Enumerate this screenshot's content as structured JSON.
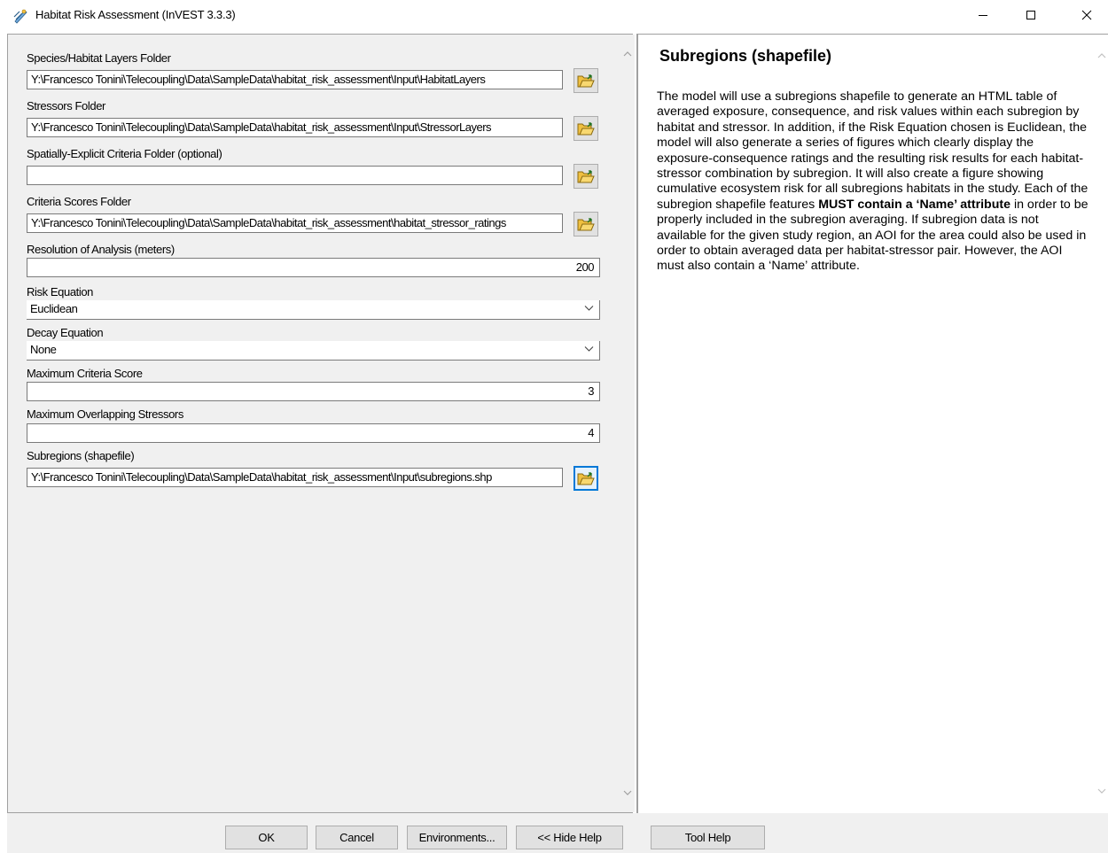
{
  "window": {
    "title": "Habitat Risk Assessment (InVEST 3.3.3)",
    "app_icon": "invest-app-icon",
    "controls": [
      "minimize-icon",
      "maximize-icon",
      "close-icon"
    ]
  },
  "form": {
    "fields": [
      {
        "label": "Species/Habitat Layers Folder",
        "value": "Y:\\Francesco Tonini\\Telecoupling\\Data\\SampleData\\habitat_risk_assessment\\Input\\HabitatLayers"
      },
      {
        "label": "Stressors Folder",
        "value": "Y:\\Francesco Tonini\\Telecoupling\\Data\\SampleData\\habitat_risk_assessment\\Input\\StressorLayers"
      },
      {
        "label": "Spatially-Explicit Criteria Folder (optional)",
        "value": ""
      },
      {
        "label": "Criteria Scores Folder",
        "value": "Y:\\Francesco Tonini\\Telecoupling\\Data\\SampleData\\habitat_risk_assessment\\habitat_stressor_ratings"
      },
      {
        "label": "Resolution of Analysis (meters)",
        "value": "200"
      },
      {
        "label": "Risk Equation",
        "value": "Euclidean"
      },
      {
        "label": "Decay Equation",
        "value": "None"
      },
      {
        "label": "Maximum Criteria Score",
        "value": "3"
      },
      {
        "label": "Maximum Overlapping Stressors",
        "value": "4"
      },
      {
        "label": "Subregions (shapefile)",
        "value": "Y:\\Francesco Tonini\\Telecoupling\\Data\\SampleData\\habitat_risk_assessment\\Input\\subregions.shp"
      }
    ]
  },
  "help": {
    "title": "Subregions (shapefile)",
    "text_1": "The model will use a subregions shapefile to generate an HTML table of averaged exposure, consequence, and risk values within each subregion by habitat and stressor. In addition, if the Risk Equation chosen is Euclidean, the model will also generate a series of figures which clearly display the exposure-consequence ratings and the resulting risk results for each habitat-stressor combination by subregion. It will also create a figure showing cumulative ecosystem risk for all subregions habitats in the study. Each of the subregion shapefile features ",
    "text_bold": "MUST contain a ‘Name’ attribute",
    "text_2": " in order to be properly included in the subregion averaging. If subregion data is not available for the given study region, an AOI for the area could also be used in order to obtain averaged data per habitat-stressor pair. However, the AOI must also contain a ‘Name’ attribute."
  },
  "buttons": {
    "ok": "OK",
    "cancel": "Cancel",
    "environments": "Environments...",
    "hide_help": "<< Hide Help",
    "tool_help": "Tool Help"
  }
}
